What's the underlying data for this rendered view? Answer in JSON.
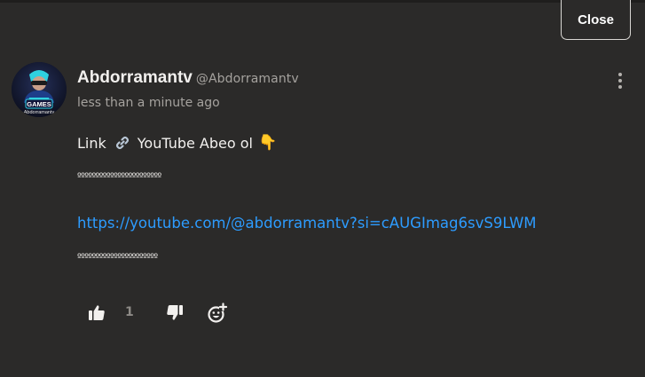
{
  "dialog": {
    "close_label": "Close"
  },
  "comment": {
    "author_name": "Abdorramantv",
    "author_handle": "@Abdorramantv",
    "timestamp": "less than a minute ago",
    "avatar_text": "GAMES",
    "avatar_subtext": "Abdorramantv",
    "line1_text_a": "Link",
    "line1_icon": "link-emoji",
    "line1_text_b": "YouTube Abeo ol",
    "line1_emoji": "👇",
    "dots_line_1": "ººººººººººººººººººººººº",
    "link_url": "https://youtube.com/@abdorramantv?si=cAUGImag6svS9LWM",
    "dots_line_2": "ºººººººººººººººººººººº"
  },
  "actions": {
    "like_icon": "thumbs-up-icon",
    "like_count": "1",
    "dislike_icon": "thumbs-down-icon",
    "react_icon": "add-reaction-icon"
  },
  "colors": {
    "background": "#2b2a29",
    "link": "#2d9cff",
    "muted_text": "#a5a29e"
  }
}
